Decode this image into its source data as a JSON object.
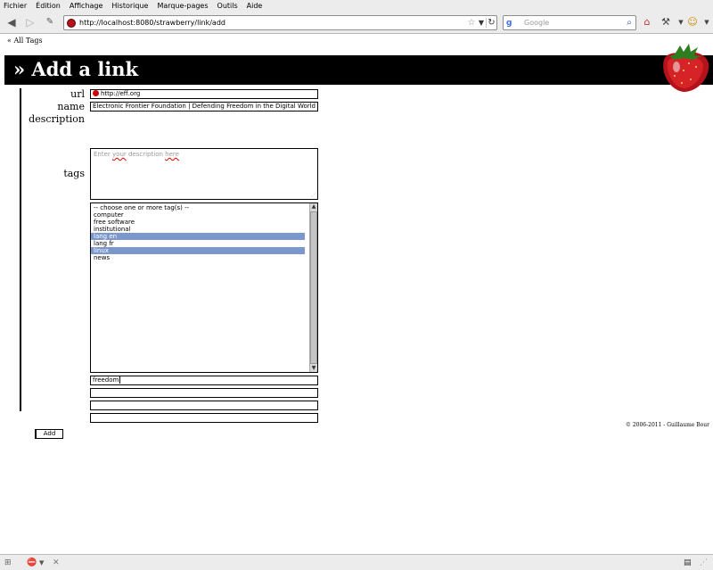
{
  "menu": [
    "Fichier",
    "Édition",
    "Affichage",
    "Historique",
    "Marque-pages",
    "Outils",
    "Aide"
  ],
  "browser": {
    "url": "http://localhost:8080/strawberry/link/add",
    "search_placeholder": "Google",
    "search_engine_logo": "g"
  },
  "page": {
    "back_link": "« All Tags",
    "title": "» Add a link",
    "copyright": "© 2006-2011 - Guillaume Bour"
  },
  "form": {
    "url_label": "url",
    "url_value": "http://eff.org",
    "name_label": "name",
    "name_value": "Electronic Frontier Foundation | Defending Freedom in the Digital World",
    "description_label": "description",
    "description_placeholder_pre": "Enter ",
    "description_placeholder_word1": "your",
    "description_placeholder_mid": " description ",
    "description_placeholder_word2": "here",
    "tags_label": "tags",
    "tags_options": [
      {
        "label": "-- choose one or more tag(s) --",
        "selected": false
      },
      {
        "label": "computer",
        "selected": false
      },
      {
        "label": "free software",
        "selected": false
      },
      {
        "label": "institutional",
        "selected": false
      },
      {
        "label": "lang en",
        "selected": true
      },
      {
        "label": "lang fr",
        "selected": false
      },
      {
        "label": "linux",
        "selected": true
      },
      {
        "label": "news",
        "selected": false
      }
    ],
    "new_tag_1": "freedom",
    "new_tag_2": "",
    "new_tag_3": "",
    "new_tag_4": "",
    "submit_label": "Add"
  },
  "colors": {
    "title_bar": "#000000",
    "selected_option": "#7b97cb"
  }
}
